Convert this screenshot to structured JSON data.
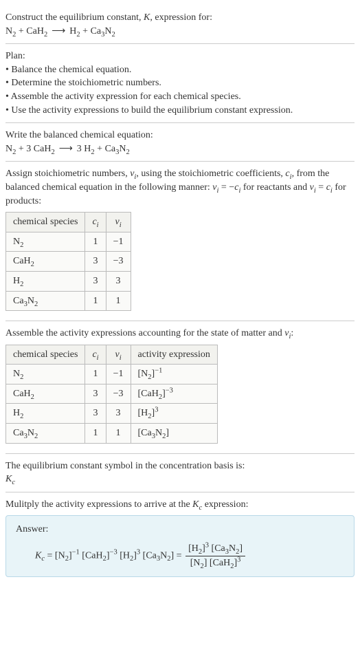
{
  "s1": {
    "line1_a": "Construct the equilibrium constant, ",
    "line1_b": "K",
    "line1_c": ", expression for:",
    "eq_lhs1": "N",
    "eq_lhs1s": "2",
    "plus": " + ",
    "eq_lhs2": "CaH",
    "eq_lhs2s": "2",
    "arrow": "⟶",
    "eq_rhs1": "H",
    "eq_rhs1s": "2",
    "eq_rhs2": "Ca",
    "eq_rhs2s1": "3",
    "eq_rhs2b": "N",
    "eq_rhs2s2": "2"
  },
  "s2": {
    "title": "Plan:",
    "b1": "• Balance the chemical equation.",
    "b2": "• Determine the stoichiometric numbers.",
    "b3": "• Assemble the activity expression for each chemical species.",
    "b4": "• Use the activity expressions to build the equilibrium constant expression."
  },
  "s3": {
    "title": "Write the balanced chemical equation:",
    "c1": "N",
    "c1s": "2",
    "c2a": "3 CaH",
    "c2s": "2",
    "c3a": "3 H",
    "c3s": "2",
    "c4a": "Ca",
    "c4s1": "3",
    "c4b": "N",
    "c4s2": "2"
  },
  "s4": {
    "p1a": "Assign stoichiometric numbers, ",
    "p1b": "ν",
    "p1bi": "i",
    "p1c": ", using the stoichiometric coefficients, ",
    "p1d": "c",
    "p1di": "i",
    "p1e": ", from the balanced chemical equation in the following manner: ",
    "p1f": "ν",
    "p1fi": "i",
    "p1g": " = −",
    "p1h": "c",
    "p1hi": "i",
    "p1i": " for reactants and ",
    "p1j": "ν",
    "p1ji": "i",
    "p1k": " = ",
    "p1l": "c",
    "p1li": "i",
    "p1m": " for products:",
    "h1": "chemical species",
    "h2": "c",
    "h2i": "i",
    "h3": "ν",
    "h3i": "i",
    "r1c1a": "N",
    "r1c1s": "2",
    "r1c2": "1",
    "r1c3": "−1",
    "r2c1a": "CaH",
    "r2c1s": "2",
    "r2c2": "3",
    "r2c3": "−3",
    "r3c1a": "H",
    "r3c1s": "2",
    "r3c2": "3",
    "r3c3": "3",
    "r4c1a": "Ca",
    "r4c1s1": "3",
    "r4c1b": "N",
    "r4c1s2": "2",
    "r4c2": "1",
    "r4c3": "1"
  },
  "s5": {
    "p1a": "Assemble the activity expressions accounting for the state of matter and ",
    "p1b": "ν",
    "p1bi": "i",
    "p1c": ":",
    "h1": "chemical species",
    "h2": "c",
    "h2i": "i",
    "h3": "ν",
    "h3i": "i",
    "h4": "activity expression",
    "r1c1a": "N",
    "r1c1s": "2",
    "r1c2": "1",
    "r1c3": "−1",
    "r1c4a": "[N",
    "r1c4s": "2",
    "r1c4b": "]",
    "r1c4e": "−1",
    "r2c1a": "CaH",
    "r2c1s": "2",
    "r2c2": "3",
    "r2c3": "−3",
    "r2c4a": "[CaH",
    "r2c4s": "2",
    "r2c4b": "]",
    "r2c4e": "−3",
    "r3c1a": "H",
    "r3c1s": "2",
    "r3c2": "3",
    "r3c3": "3",
    "r3c4a": "[H",
    "r3c4s": "2",
    "r3c4b": "]",
    "r3c4e": "3",
    "r4c1a": "Ca",
    "r4c1s1": "3",
    "r4c1b": "N",
    "r4c1s2": "2",
    "r4c2": "1",
    "r4c3": "1",
    "r4c4a": "[Ca",
    "r4c4s1": "3",
    "r4c4b": "N",
    "r4c4s2": "2",
    "r4c4c": "]"
  },
  "s6": {
    "p1": "The equilibrium constant symbol in the concentration basis is:",
    "sym": "K",
    "symi": "c"
  },
  "s7": {
    "p1a": "Mulitply the activity expressions to arrive at the ",
    "p1b": "K",
    "p1bi": "c",
    "p1c": " expression:",
    "ans": "Answer:",
    "lhs1": "K",
    "lhs1i": "c",
    "eq": " = ",
    "t1a": "[N",
    "t1s": "2",
    "t1b": "]",
    "t1e": "−1",
    "t2a": " [CaH",
    "t2s": "2",
    "t2b": "]",
    "t2e": "−3",
    "t3a": " [H",
    "t3s": "2",
    "t3b": "]",
    "t3e": "3",
    "t4a": " [Ca",
    "t4s1": "3",
    "t4b": "N",
    "t4s2": "2",
    "t4c": "] = ",
    "num1a": "[H",
    "num1s": "2",
    "num1b": "]",
    "num1e": "3",
    "num2a": " [Ca",
    "num2s1": "3",
    "num2b": "N",
    "num2s2": "2",
    "num2c": "]",
    "den1a": "[N",
    "den1s": "2",
    "den1b": "] ",
    "den2a": "[CaH",
    "den2s": "2",
    "den2b": "]",
    "den2e": "3"
  }
}
